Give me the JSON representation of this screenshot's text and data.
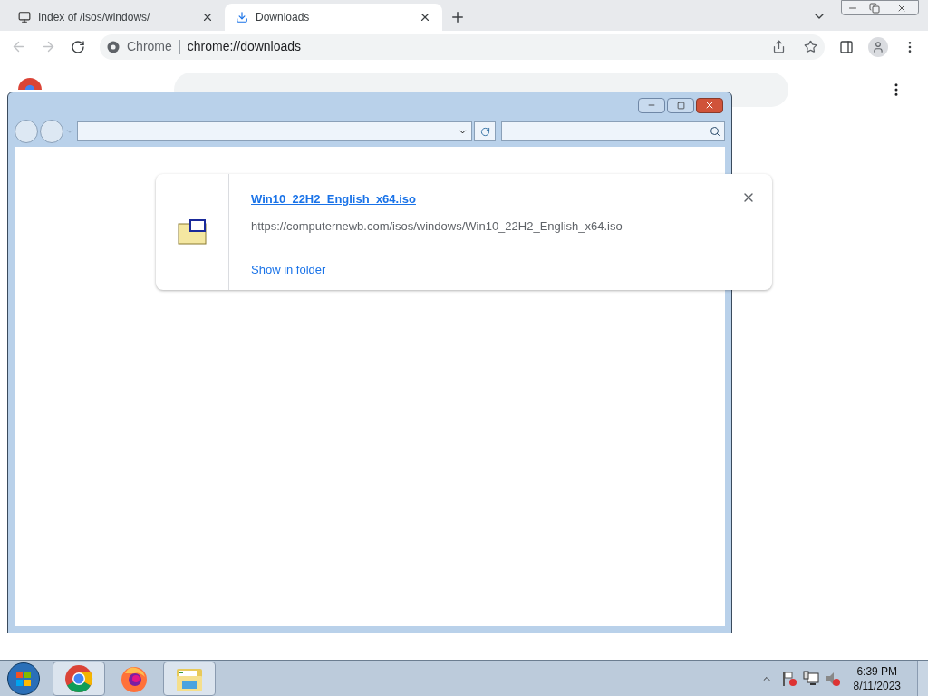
{
  "browser": {
    "tabs": [
      {
        "title": "Index of /isos/windows/",
        "kind": "page",
        "selected": false
      },
      {
        "title": "Downloads",
        "kind": "downloads",
        "selected": true
      }
    ],
    "omnibox": {
      "chip": "Chrome",
      "url": "chrome://downloads"
    }
  },
  "page": {
    "download": {
      "file_name": "Win10_22H2_English_x64.iso",
      "url": "https://computernewb.com/isos/windows/Win10_22H2_English_x64.iso",
      "action": "Show in folder"
    }
  },
  "taskbar": {
    "apps": [
      {
        "kind": "chrome",
        "running": true
      },
      {
        "kind": "firefox",
        "running": false
      },
      {
        "kind": "explorer",
        "running": true
      }
    ],
    "time": "6:39 PM",
    "date": "8/11/2023"
  }
}
